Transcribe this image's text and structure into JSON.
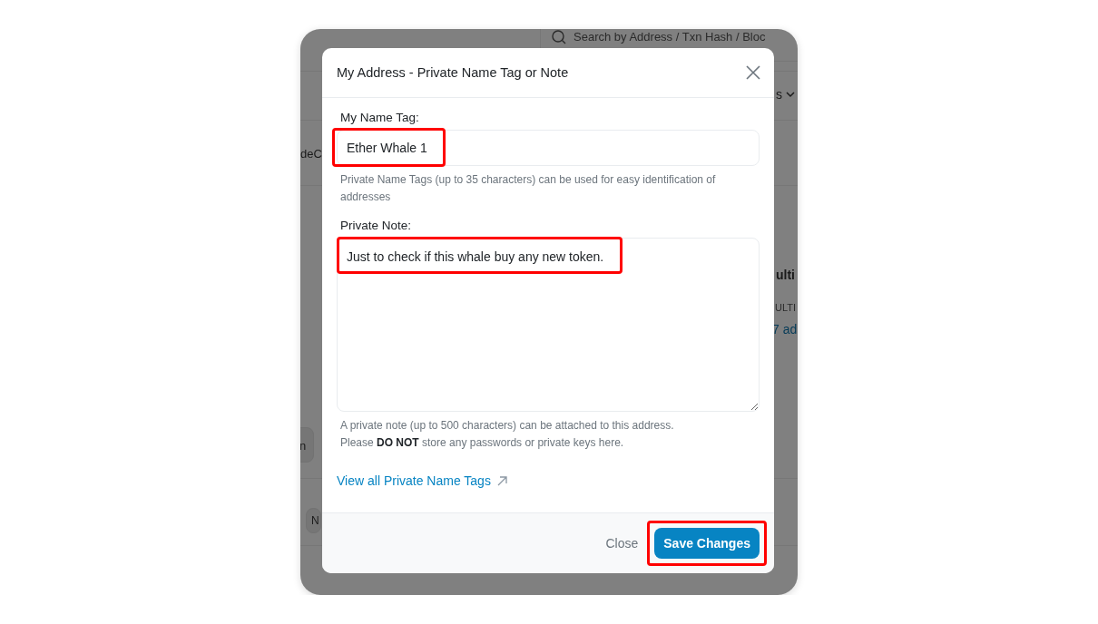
{
  "background": {
    "search": {
      "placeholder": "Search by Address / Txn Hash / Bloc"
    },
    "menu_label": "s",
    "address_fragment": "deC",
    "card_title": "ulti",
    "card_label": "ULTI",
    "card_link": "7 ad",
    "chip_1": "n",
    "chip_2": "N"
  },
  "dialog": {
    "title": "My Address - Private Name Tag or Note",
    "fields": [
      {
        "kind": "input",
        "label": "My Name Tag:",
        "value": "Ether Whale 1",
        "help_lines": [
          "Private Name Tags (up to 35 characters) can be used for easy identification of addresses"
        ],
        "highlighted": true
      },
      {
        "kind": "textarea",
        "label": "Private Note:",
        "value": "Just to check if this whale buy any new token.",
        "help_lines": [
          "A private note (up to 500 characters) can be attached to this address.",
          "Please **DO NOT** store any passwords or private keys here."
        ],
        "highlighted": true
      }
    ],
    "link": "View all Private Name Tags",
    "buttons": [
      {
        "kind": "plain",
        "label": "Close",
        "highlighted": false
      },
      {
        "kind": "primary",
        "label": "Save Changes",
        "highlighted": true
      }
    ]
  }
}
